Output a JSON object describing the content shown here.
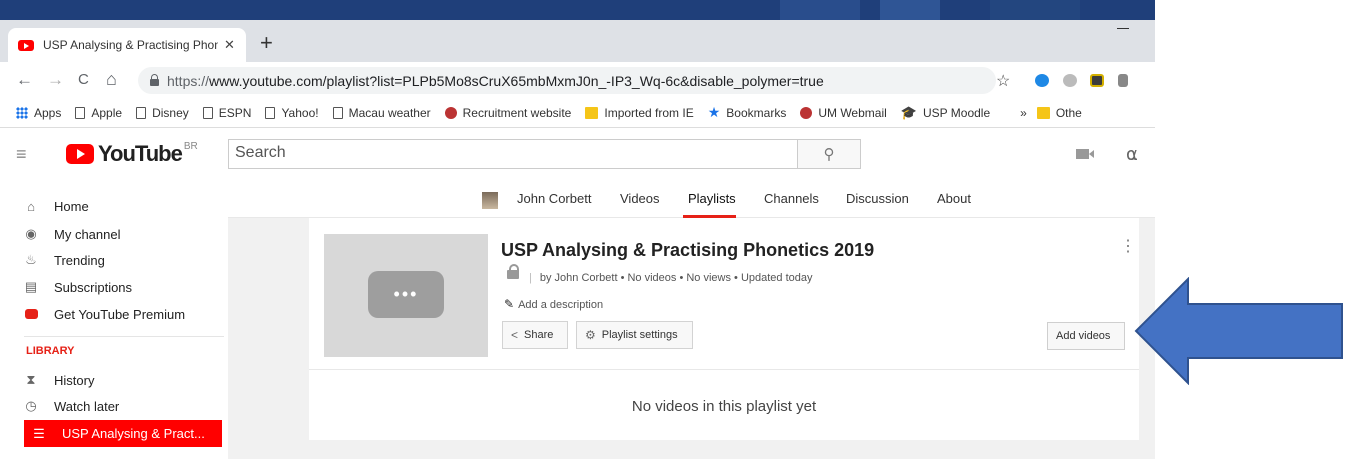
{
  "browser": {
    "tab_title": "USP Analysing & Practising Phon",
    "tab_close": "✕",
    "new_tab": "+",
    "url_protocol": "https://",
    "url_rest": "www.youtube.com/playlist?list=PLPb5Mo8sCruX65mbMxmJ0n_-IP3_Wq-6c&disable_polymer=true",
    "nav": {
      "back": "←",
      "forward": "→",
      "reload": "C",
      "home": "⌂"
    },
    "star": "☆",
    "bookmarks": [
      {
        "label": "Apps",
        "icon": "apps-grid-icon"
      },
      {
        "label": "Apple",
        "icon": "page-icon"
      },
      {
        "label": "Disney",
        "icon": "page-icon"
      },
      {
        "label": "ESPN",
        "icon": "page-icon"
      },
      {
        "label": "Yahoo!",
        "icon": "page-icon"
      },
      {
        "label": "Macau weather",
        "icon": "page-icon"
      },
      {
        "label": "Recruitment website",
        "icon": "um-logo-icon"
      },
      {
        "label": "Imported from IE",
        "icon": "folder-icon"
      },
      {
        "label": "Bookmarks",
        "icon": "star-icon"
      },
      {
        "label": "UM Webmail",
        "icon": "um-logo-icon"
      },
      {
        "label": "USP Moodle",
        "icon": "graduation-cap-icon"
      }
    ],
    "bookmarks_more": "»",
    "bookmarks_other": "Othe"
  },
  "youtube": {
    "logo_text": "YouTube",
    "logo_region": "BR",
    "search_placeholder": "Search",
    "search_icon": "⚲",
    "bell_icon": "🔔"
  },
  "sidebar": {
    "items": [
      {
        "label": "Home",
        "icon": "⌂"
      },
      {
        "label": "My channel",
        "icon": "◉"
      },
      {
        "label": "Trending",
        "icon": "♨"
      },
      {
        "label": "Subscriptions",
        "icon": "▤"
      },
      {
        "label": "Get YouTube Premium",
        "icon": ""
      }
    ],
    "library_heading": "LIBRARY",
    "library_items": [
      {
        "label": "History",
        "icon": "⧗"
      },
      {
        "label": "Watch later",
        "icon": "◷"
      },
      {
        "label": "USP Analysing & Pract...",
        "icon": "☰"
      }
    ]
  },
  "channel_nav": {
    "items": [
      "John Corbett",
      "Videos",
      "Playlists",
      "Channels",
      "Discussion",
      "About"
    ],
    "active": "Playlists"
  },
  "playlist": {
    "title": "USP Analysing & Practising Phonetics 2019",
    "meta_sep": "|",
    "meta": "by John Corbett • No videos • No views • Updated today",
    "add_description": "Add a description",
    "share_label": "Share",
    "settings_label": "Playlist settings",
    "add_videos_label": "Add videos",
    "more": "⋮",
    "thumb_dots": "•••",
    "empty_message": "No videos in this playlist yet"
  },
  "colors": {
    "brand_red": "#ff0000",
    "arrow_fill": "#4472c4",
    "arrow_stroke": "#2f528f"
  }
}
